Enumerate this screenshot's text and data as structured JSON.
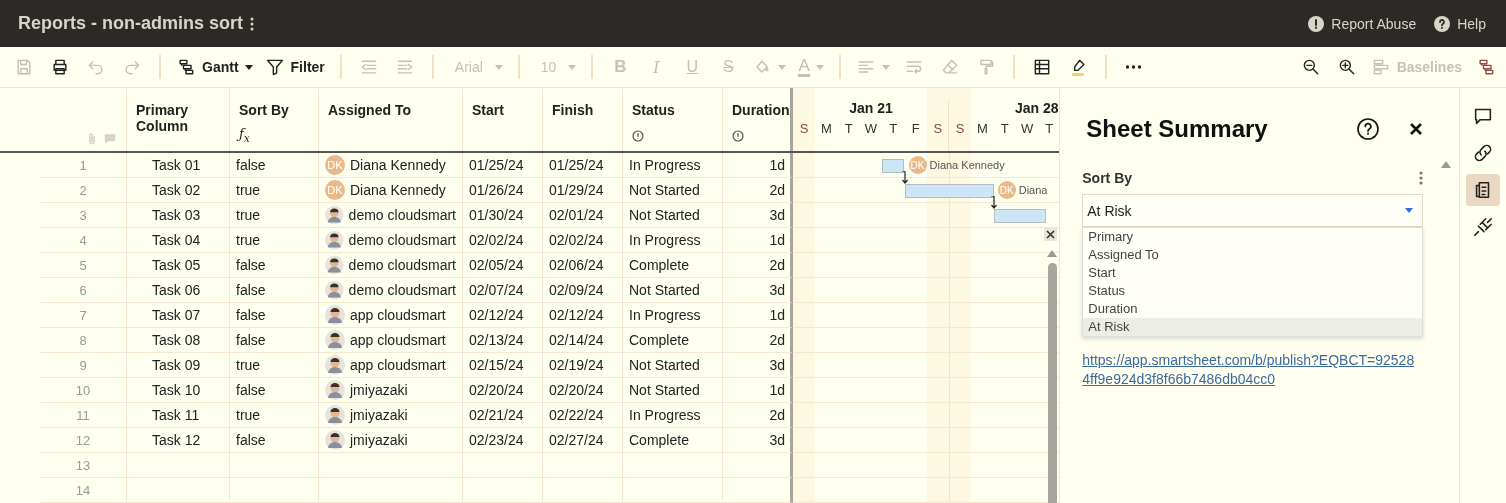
{
  "topbar": {
    "title": "Reports - non-admins sort",
    "links": [
      {
        "kind": "report",
        "label": "Report Abuse"
      },
      {
        "kind": "help",
        "label": "Help"
      }
    ]
  },
  "toolbar": {
    "left": [
      [
        {
          "kind": "save",
          "disabled": true,
          "dropdown": false
        },
        {
          "kind": "print",
          "disabled": false,
          "dropdown": false
        },
        {
          "kind": "undo",
          "disabled": true,
          "dropdown": false
        },
        {
          "kind": "redo",
          "disabled": true,
          "dropdown": false
        }
      ],
      [
        {
          "kind": "gantt-view",
          "label": "Gantt",
          "disabled": false,
          "dropdown": true
        },
        {
          "kind": "filter",
          "label": "Filter",
          "disabled": false,
          "dropdown": false
        }
      ],
      [
        {
          "kind": "outdent",
          "disabled": true,
          "dropdown": false
        },
        {
          "kind": "indent",
          "disabled": true,
          "dropdown": false
        }
      ],
      [
        {
          "kind": "font",
          "label": "Arial",
          "disabled": true,
          "dropdown": true
        }
      ],
      [
        {
          "kind": "font-size",
          "label": "10",
          "disabled": true,
          "dropdown": true
        }
      ],
      [
        {
          "kind": "bold",
          "label": "B",
          "disabled": true,
          "dropdown": false
        },
        {
          "kind": "italic",
          "label": "I",
          "disabled": true,
          "dropdown": false
        },
        {
          "kind": "underline",
          "label": "U",
          "disabled": true,
          "dropdown": false
        },
        {
          "kind": "strikethrough",
          "label": "S",
          "disabled": true,
          "dropdown": false
        },
        {
          "kind": "fill-color",
          "disabled": true,
          "dropdown": true
        },
        {
          "kind": "text-color",
          "label": "A",
          "disabled": true,
          "dropdown": true
        }
      ],
      [
        {
          "kind": "align",
          "disabled": true,
          "dropdown": true
        },
        {
          "kind": "wrap",
          "disabled": true,
          "dropdown": false
        },
        {
          "kind": "clear-format",
          "disabled": true,
          "dropdown": false
        },
        {
          "kind": "format-painter",
          "disabled": true,
          "dropdown": false
        }
      ],
      [
        {
          "kind": "grid",
          "disabled": false,
          "dropdown": false
        },
        {
          "kind": "highlight",
          "disabled": false,
          "dropdown": false
        }
      ],
      [
        {
          "kind": "more",
          "disabled": false,
          "dropdown": false
        }
      ]
    ],
    "right": [
      {
        "kind": "zoom-out",
        "disabled": false
      },
      {
        "kind": "zoom-in",
        "disabled": false
      },
      {
        "kind": "baselines",
        "label": "Baselines",
        "disabled": true
      },
      {
        "kind": "gantt-panel",
        "disabled": false
      }
    ]
  },
  "table": {
    "columns": [
      {
        "label": "Primary Column",
        "kind": "plain"
      },
      {
        "label": "Sort By",
        "kind": "formula",
        "marker": "ƒ$_{x}$"
      },
      {
        "label": "Assigned To",
        "kind": "plain"
      },
      {
        "label": "Start",
        "kind": "plain"
      },
      {
        "label": "Finish",
        "kind": "plain"
      },
      {
        "label": "Status",
        "kind": "info"
      },
      {
        "label": "Duration",
        "kind": "info"
      }
    ],
    "rows": [
      {
        "num": "1",
        "task": "Task 01",
        "sort_by": "false",
        "avatar": {
          "kind": "initials",
          "text": "DK"
        },
        "assigned": "Diana Kennedy",
        "start": "01/25/24",
        "finish": "01/25/24",
        "status": "In Progress",
        "duration": "1d",
        "gantt_label": {
          "initials": "DK",
          "name": "Diana Kennedy"
        }
      },
      {
        "num": "2",
        "task": "Task 02",
        "sort_by": "true",
        "avatar": {
          "kind": "initials",
          "text": "DK"
        },
        "assigned": "Diana Kennedy",
        "start": "01/26/24",
        "finish": "01/29/24",
        "status": "Not Started",
        "duration": "2d",
        "gantt_label": {
          "initials": "DK",
          "name": "Diana"
        }
      },
      {
        "num": "3",
        "task": "Task 03",
        "sort_by": "true",
        "avatar": {
          "kind": "photo"
        },
        "assigned": "demo cloudsmart",
        "start": "01/30/24",
        "finish": "02/01/24",
        "status": "Not Started",
        "duration": "3d"
      },
      {
        "num": "4",
        "task": "Task 04",
        "sort_by": "true",
        "avatar": {
          "kind": "photo"
        },
        "assigned": "demo cloudsmart",
        "start": "02/02/24",
        "finish": "02/02/24",
        "status": "In Progress",
        "duration": "1d"
      },
      {
        "num": "5",
        "task": "Task 05",
        "sort_by": "false",
        "avatar": {
          "kind": "photo"
        },
        "assigned": "demo cloudsmart",
        "start": "02/05/24",
        "finish": "02/06/24",
        "status": "Complete",
        "duration": "2d"
      },
      {
        "num": "6",
        "task": "Task 06",
        "sort_by": "false",
        "avatar": {
          "kind": "photo"
        },
        "assigned": "demo cloudsmart",
        "start": "02/07/24",
        "finish": "02/09/24",
        "status": "Not Started",
        "duration": "3d"
      },
      {
        "num": "7",
        "task": "Task 07",
        "sort_by": "false",
        "avatar": {
          "kind": "photo"
        },
        "assigned": "app cloudsmart",
        "start": "02/12/24",
        "finish": "02/12/24",
        "status": "In Progress",
        "duration": "1d"
      },
      {
        "num": "8",
        "task": "Task 08",
        "sort_by": "false",
        "avatar": {
          "kind": "photo"
        },
        "assigned": "app cloudsmart",
        "start": "02/13/24",
        "finish": "02/14/24",
        "status": "Complete",
        "duration": "2d"
      },
      {
        "num": "9",
        "task": "Task 09",
        "sort_by": "true",
        "avatar": {
          "kind": "photo"
        },
        "assigned": "app cloudsmart",
        "start": "02/15/24",
        "finish": "02/19/24",
        "status": "Not Started",
        "duration": "3d"
      },
      {
        "num": "10",
        "task": "Task 10",
        "sort_by": "false",
        "avatar": {
          "kind": "photo"
        },
        "assigned": "jmiyazaki",
        "start": "02/20/24",
        "finish": "02/20/24",
        "status": "Not Started",
        "duration": "1d"
      },
      {
        "num": "11",
        "task": "Task 11",
        "sort_by": "true",
        "avatar": {
          "kind": "photo"
        },
        "assigned": "jmiyazaki",
        "start": "02/21/24",
        "finish": "02/22/24",
        "status": "In Progress",
        "duration": "2d"
      },
      {
        "num": "12",
        "task": "Task 12",
        "sort_by": "false",
        "avatar": {
          "kind": "photo"
        },
        "assigned": "jmiyazaki",
        "start": "02/23/24",
        "finish": "02/27/24",
        "status": "Complete",
        "duration": "3d"
      },
      {
        "num": "13"
      },
      {
        "num": "14"
      }
    ]
  },
  "gantt": {
    "weeks": [
      {
        "label": "Jan 21",
        "days": [
          "S",
          "M",
          "T",
          "W",
          "T",
          "F",
          "S"
        ]
      },
      {
        "label": "Jan 28",
        "days": [
          "S",
          "M",
          "T",
          "W",
          "T"
        ]
      }
    ]
  },
  "panel": {
    "title": "Sheet Summary",
    "field": {
      "label": "Sort By",
      "value": "At Risk",
      "options": [
        {
          "label": "Primary",
          "selected": false
        },
        {
          "label": "Assigned To",
          "selected": false
        },
        {
          "label": "Start",
          "selected": false
        },
        {
          "label": "Status",
          "selected": false
        },
        {
          "label": "Duration",
          "selected": false
        },
        {
          "label": "At Risk",
          "selected": true
        }
      ]
    },
    "link": "https://app.smartsheet.com/b/publish?EQBCT=925284ff9e924d3f8f66b7486db04cc0"
  },
  "rail": [
    {
      "kind": "comments",
      "selected": false
    },
    {
      "kind": "attachments",
      "selected": false
    },
    {
      "kind": "summary",
      "selected": true
    },
    {
      "kind": "connections",
      "selected": false
    }
  ]
}
